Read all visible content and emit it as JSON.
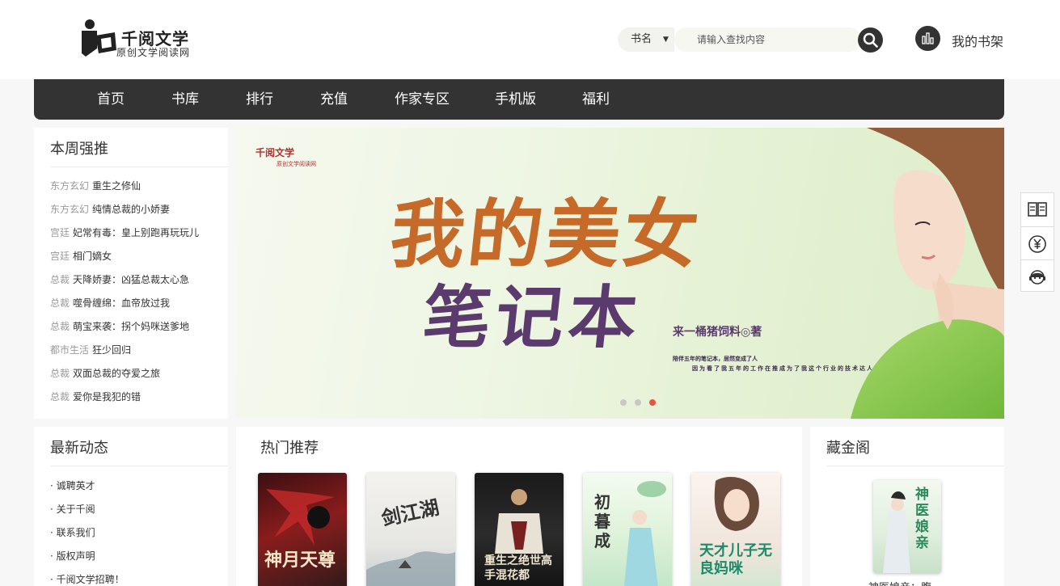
{
  "header": {
    "logo_title": "千阅文学",
    "logo_subtitle": "原创文学阅读网",
    "search_type": "书名",
    "search_placeholder": "请输入查找内容",
    "shelf_label": "我的书架"
  },
  "nav": {
    "items": [
      "首页",
      "书库",
      "排行",
      "充值",
      "作家专区",
      "手机版",
      "福利"
    ]
  },
  "weekly": {
    "title": "本周强推",
    "items": [
      {
        "category": "东方玄幻",
        "title": "重生之修仙"
      },
      {
        "category": "东方玄幻",
        "title": "纯情总裁的小娇妻"
      },
      {
        "category": "宫廷",
        "title": "妃常有毒：皇上别跑再玩玩儿"
      },
      {
        "category": "宫廷",
        "title": "相门嫡女"
      },
      {
        "category": "总裁",
        "title": "天降娇妻：凶猛总裁太心急"
      },
      {
        "category": "总裁",
        "title": "噬骨缠绵：血帝放过我"
      },
      {
        "category": "总裁",
        "title": "萌宝来袭：拐个妈咪送爹地"
      },
      {
        "category": "都市生活",
        "title": "狂少回归"
      },
      {
        "category": "总裁",
        "title": "双面总裁的夺爱之旅"
      },
      {
        "category": "总裁",
        "title": "爱你是我犯的错"
      }
    ]
  },
  "banner": {
    "logo": "千阅文学",
    "logo_sub": "原创文学阅读网",
    "title_line1": "我的美女",
    "title_line2": "笔记本",
    "author": "来一桶猪饲料◎著",
    "tagline1": "陪伴五年的笔记本，居然变成了人",
    "tagline2": "因为看了我五年的工作在推成为了我这个行业的技术达人，啊—",
    "active_slide": 3,
    "slide_count": 3
  },
  "news": {
    "title": "最新动态",
    "items": [
      "· 诚聘英才",
      "· 关于千阅",
      "· 联系我们",
      "· 版权声明",
      "· 千阅文学招聘！"
    ]
  },
  "hot": {
    "title": "热门推荐",
    "books": [
      {
        "cover_title": "神月天尊"
      },
      {
        "cover_title": "剑江湖"
      },
      {
        "cover_title": "重生之绝世高手混花都"
      },
      {
        "cover_title": "初暮成"
      },
      {
        "cover_title": "天才儿子无良妈咪"
      }
    ]
  },
  "vault": {
    "title": "藏金阁",
    "cover_title": "神医娘亲",
    "book_name": "神医娘亲：腹"
  },
  "colors": {
    "nav_bg": "#333333",
    "accent_dot": "#e8533a",
    "banner_title": "#c66a2a",
    "banner_title2": "#5b3a6e"
  },
  "icons": [
    "logo-icon",
    "search-icon",
    "bookshelf-icon",
    "book-icon",
    "yen-icon",
    "customer-service-icon"
  ]
}
